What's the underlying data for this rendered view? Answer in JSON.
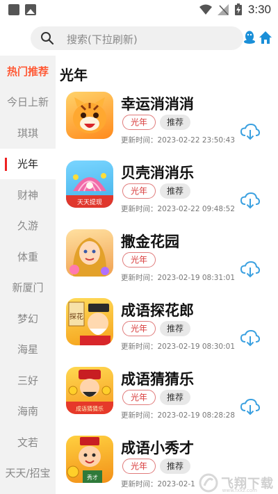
{
  "status_bar": {
    "time": "3:30"
  },
  "search": {
    "placeholder": "搜索(下拉刷新)"
  },
  "sidebar": {
    "items": [
      {
        "label": "热门推荐"
      },
      {
        "label": "今日上新"
      },
      {
        "label": "琪琪"
      },
      {
        "label": "光年"
      },
      {
        "label": "财神"
      },
      {
        "label": "久游"
      },
      {
        "label": "体重"
      },
      {
        "label": "新厦门"
      },
      {
        "label": "梦幻"
      },
      {
        "label": "海星"
      },
      {
        "label": "三好"
      },
      {
        "label": "海南"
      },
      {
        "label": "文若"
      },
      {
        "label": "天天/招宝"
      }
    ]
  },
  "main": {
    "section_title": "光年",
    "apps": [
      {
        "name": "幸运消消消",
        "tag": "光年",
        "rec": "推荐",
        "updated": "更新时间：2023-02-22 23:50:43"
      },
      {
        "name": "贝壳消消乐",
        "tag": "光年",
        "rec": "推荐",
        "updated": "更新时间：2023-02-22 09:48:52",
        "icon_text": "天天提现"
      },
      {
        "name": "撒金花园",
        "tag": "光年",
        "updated": "更新时间：2023-02-19 08:31:01"
      },
      {
        "name": "成语探花郎",
        "tag": "光年",
        "rec": "推荐",
        "updated": "更新时间：2023-02-19 08:30:01",
        "icon_text": "探花"
      },
      {
        "name": "成语猜猜乐",
        "tag": "光年",
        "rec": "推荐",
        "updated": "更新时间：2023-02-19 08:28:28",
        "icon_text": "成语猜猜乐"
      },
      {
        "name": "成语小秀才",
        "tag": "光年",
        "rec": "推荐",
        "updated": "更新时间：2023-02-1",
        "icon_text": "秀才"
      }
    ]
  },
  "watermark": {
    "text": "飞翔下载",
    "sub": "www.fxxz.com"
  },
  "colors": {
    "accent_red": "#e22222",
    "hot_orange": "#ff5a36",
    "download_blue": "#3aa0e0",
    "search_bg": "#f0f0f0"
  }
}
